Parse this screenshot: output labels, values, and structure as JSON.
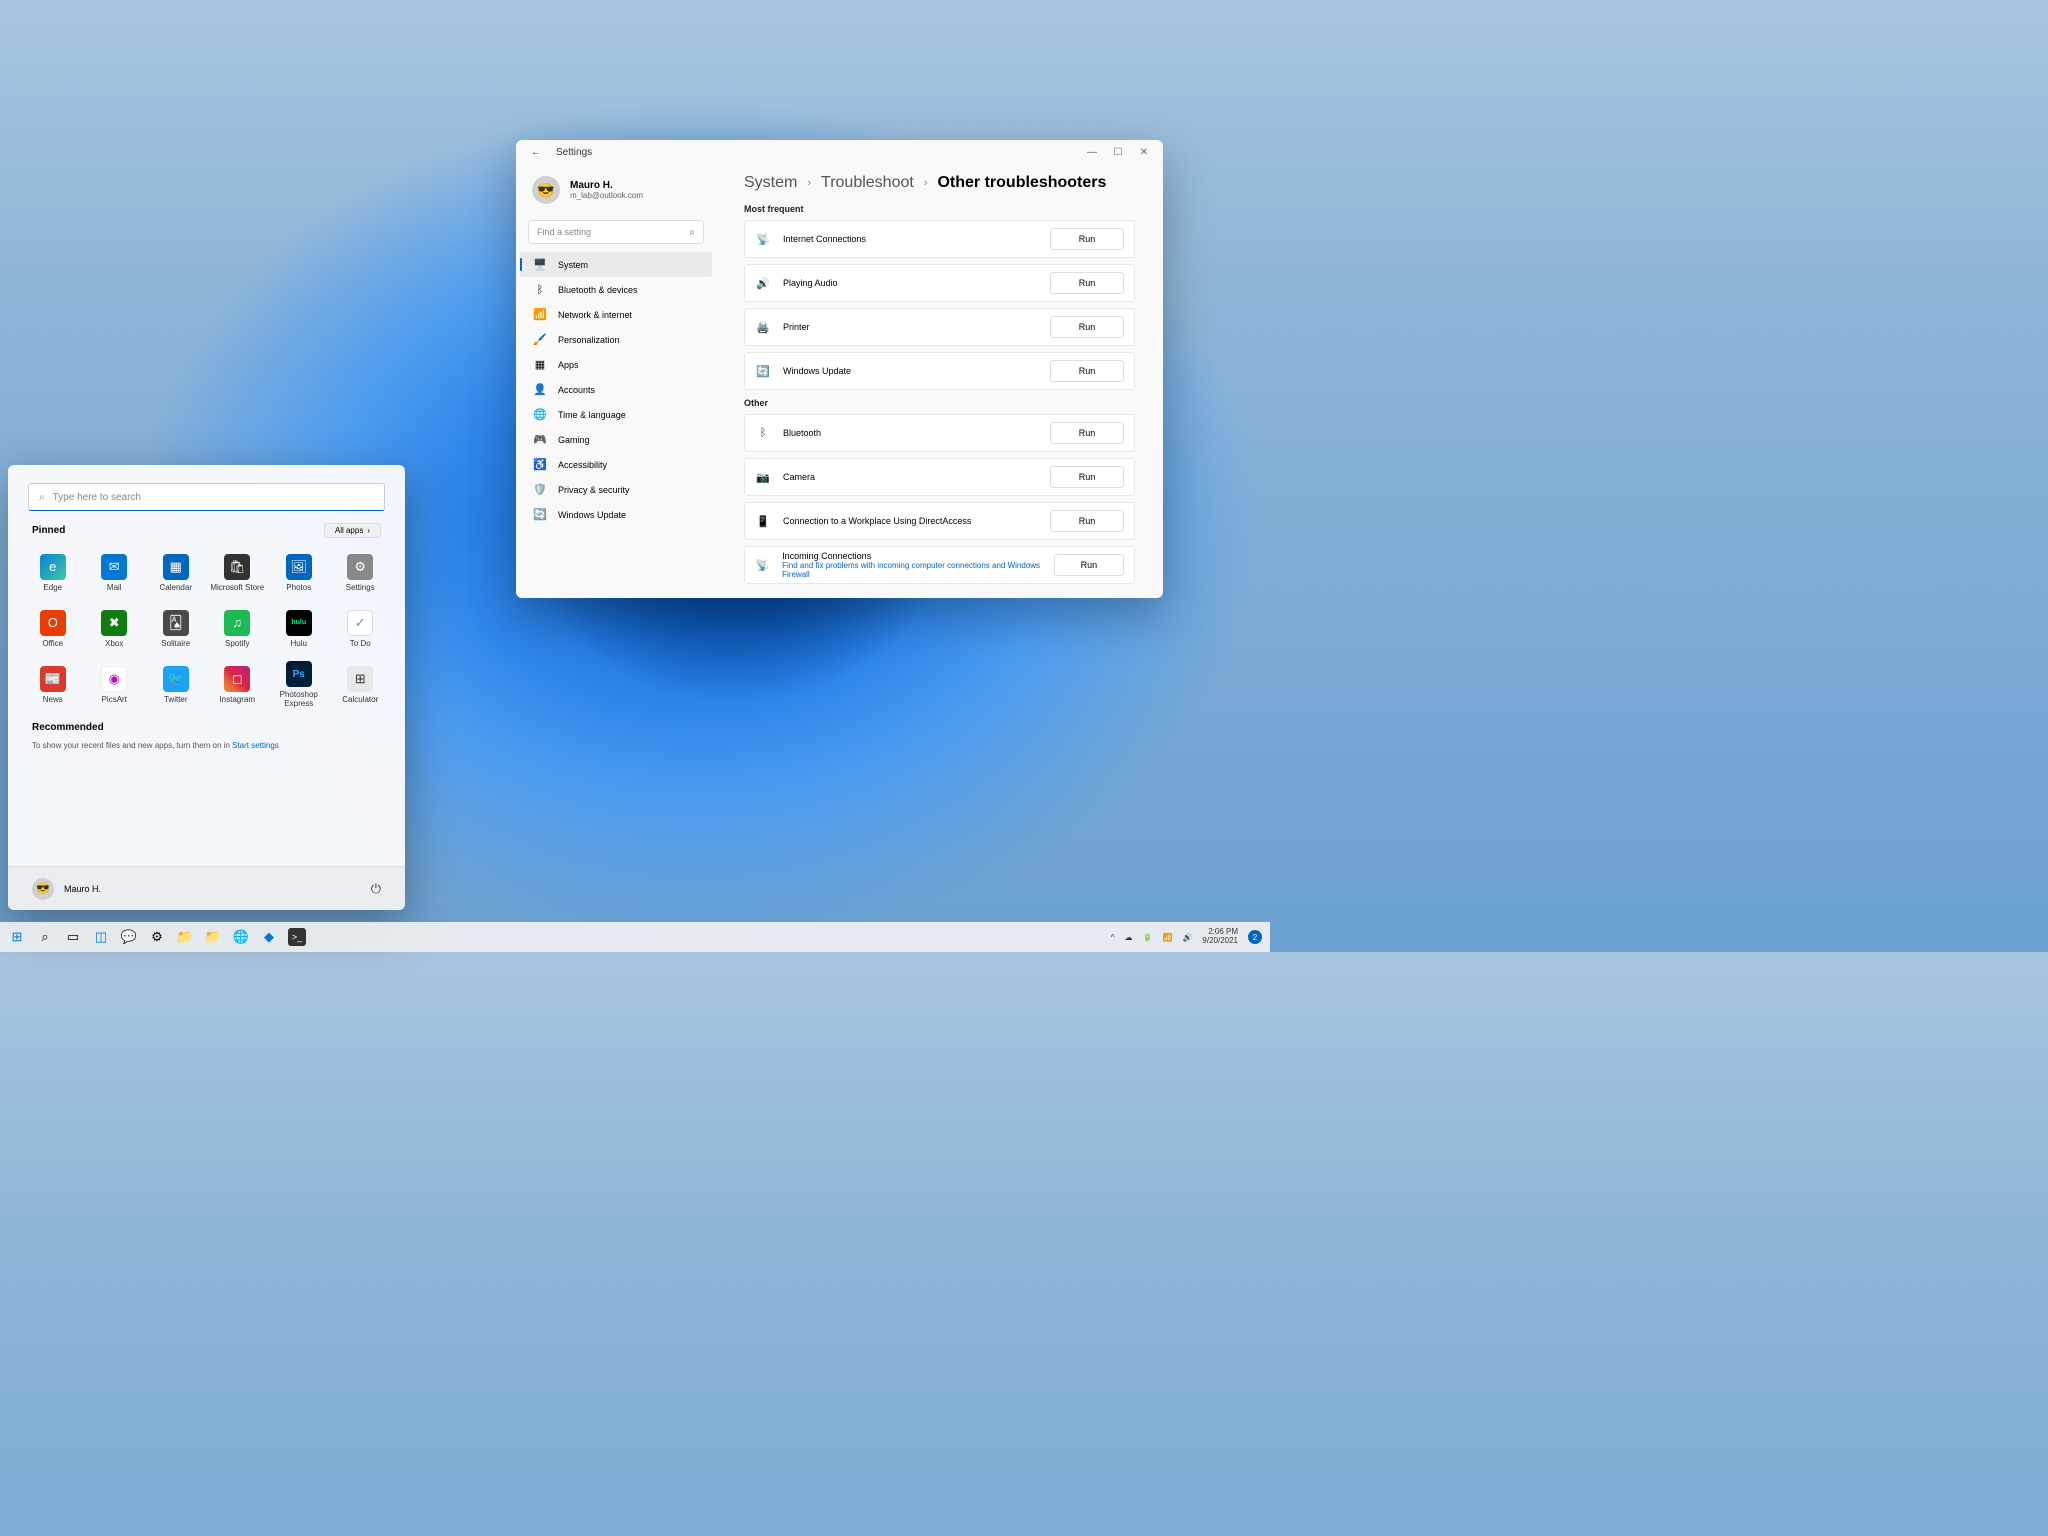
{
  "settings": {
    "title": "Settings",
    "profile": {
      "name": "Mauro H.",
      "email": "m_lab@outlook.com"
    },
    "search_placeholder": "Find a setting",
    "nav": [
      {
        "label": "System",
        "icon": "🖥️",
        "active": true
      },
      {
        "label": "Bluetooth & devices",
        "icon": "ᛒ"
      },
      {
        "label": "Network & internet",
        "icon": "📶"
      },
      {
        "label": "Personalization",
        "icon": "🖌️"
      },
      {
        "label": "Apps",
        "icon": "▦"
      },
      {
        "label": "Accounts",
        "icon": "👤"
      },
      {
        "label": "Time & language",
        "icon": "🌐"
      },
      {
        "label": "Gaming",
        "icon": "🎮"
      },
      {
        "label": "Accessibility",
        "icon": "♿"
      },
      {
        "label": "Privacy & security",
        "icon": "🛡️"
      },
      {
        "label": "Windows Update",
        "icon": "🔄"
      }
    ],
    "breadcrumb": [
      "System",
      "Troubleshoot",
      "Other troubleshooters"
    ],
    "sections": {
      "most_frequent": {
        "title": "Most frequent",
        "items": [
          {
            "label": "Internet Connections",
            "icon": "📡"
          },
          {
            "label": "Playing Audio",
            "icon": "🔊"
          },
          {
            "label": "Printer",
            "icon": "🖨️"
          },
          {
            "label": "Windows Update",
            "icon": "🔄"
          }
        ]
      },
      "other": {
        "title": "Other",
        "items": [
          {
            "label": "Bluetooth",
            "icon": "ᛒ"
          },
          {
            "label": "Camera",
            "icon": "📷"
          },
          {
            "label": "Connection to a Workplace Using DirectAccess",
            "icon": "📱"
          },
          {
            "label": "Incoming Connections",
            "icon": "📡",
            "sub": "Find and fix problems with incoming computer connections and Windows Firewall"
          }
        ]
      }
    },
    "run_label": "Run"
  },
  "start": {
    "search_placeholder": "Type here to search",
    "pinned_title": "Pinned",
    "all_apps_label": "All apps",
    "apps": [
      {
        "label": "Edge",
        "cls": "ic-edge",
        "glyph": "e"
      },
      {
        "label": "Mail",
        "cls": "ic-mail",
        "glyph": "✉"
      },
      {
        "label": "Calendar",
        "cls": "ic-cal",
        "glyph": "▦"
      },
      {
        "label": "Microsoft Store",
        "cls": "ic-store",
        "glyph": "🛍"
      },
      {
        "label": "Photos",
        "cls": "ic-photos",
        "glyph": "🖼"
      },
      {
        "label": "Settings",
        "cls": "ic-settings",
        "glyph": "⚙"
      },
      {
        "label": "Office",
        "cls": "ic-office",
        "glyph": "O"
      },
      {
        "label": "Xbox",
        "cls": "ic-xbox",
        "glyph": "✖"
      },
      {
        "label": "Solitaire",
        "cls": "ic-sol",
        "glyph": "🂡"
      },
      {
        "label": "Spotify",
        "cls": "ic-spotify",
        "glyph": "♫"
      },
      {
        "label": "Hulu",
        "cls": "ic-hulu",
        "glyph": "hulu"
      },
      {
        "label": "To Do",
        "cls": "ic-todo",
        "glyph": "✓"
      },
      {
        "label": "News",
        "cls": "ic-news",
        "glyph": "📰"
      },
      {
        "label": "PicsArt",
        "cls": "ic-picsart",
        "glyph": "◉"
      },
      {
        "label": "Twitter",
        "cls": "ic-twitter",
        "glyph": "🐦"
      },
      {
        "label": "Instagram",
        "cls": "ic-insta",
        "glyph": "◻"
      },
      {
        "label": "Photoshop Express",
        "cls": "ic-ps",
        "glyph": "Ps"
      },
      {
        "label": "Calculator",
        "cls": "ic-calc",
        "glyph": "⊞"
      }
    ],
    "rec_title": "Recommended",
    "rec_text": "To show your recent files and new apps, turn them on in ",
    "rec_link": "Start settings",
    "user": "Mauro H."
  },
  "taskbar": {
    "time": "2:06 PM",
    "date": "9/20/2021",
    "notif_count": "2"
  }
}
